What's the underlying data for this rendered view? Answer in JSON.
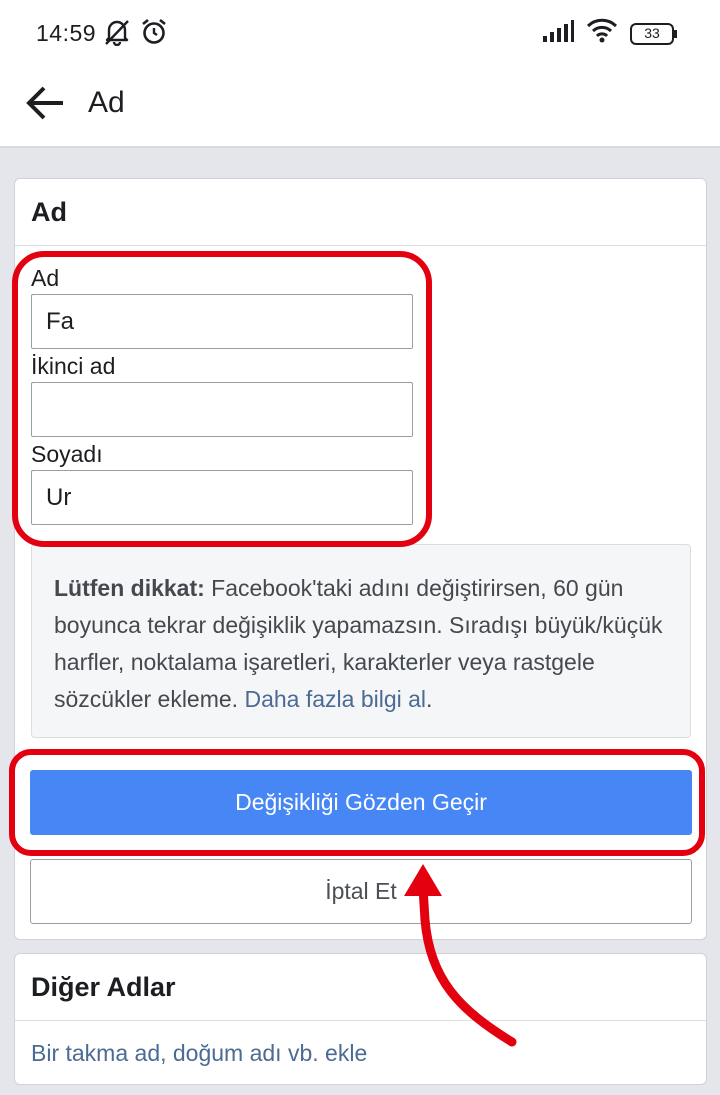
{
  "status_bar": {
    "time": "14:59",
    "battery": "33",
    "icons": [
      "muted-bell-icon",
      "alarm-clock-icon",
      "signal-icon",
      "wifi-icon",
      "battery-icon"
    ]
  },
  "app_bar": {
    "back_icon": "arrow-left-icon",
    "title": "Ad"
  },
  "name_card": {
    "title": "Ad",
    "fields": [
      {
        "label": "Ad",
        "value": "Fa"
      },
      {
        "label": "İkinci ad",
        "value": ""
      },
      {
        "label": "Soyadı",
        "value": "Ur"
      }
    ],
    "notice": {
      "bold": "Lütfen dikkat:",
      "text": " Facebook'taki adını değiştirirsen, 60 gün boyunca tekrar değişiklik yapamazsın. Sıradışı büyük/küçük harfler, noktalama işaretleri, karakterler veya rastgele sözcükler ekleme. ",
      "link": "Daha fazla bilgi al",
      "end": "."
    },
    "review_button": "Değişikliği Gözden Geçir",
    "cancel_button": "İptal Et"
  },
  "other_names_card": {
    "title": "Diğer Adlar",
    "add_link": "Bir takma ad, doğum adı vb. ekle"
  },
  "colors": {
    "primary_button": "#4786f5",
    "annotation": "#e3000f",
    "link": "#4b6a94"
  }
}
